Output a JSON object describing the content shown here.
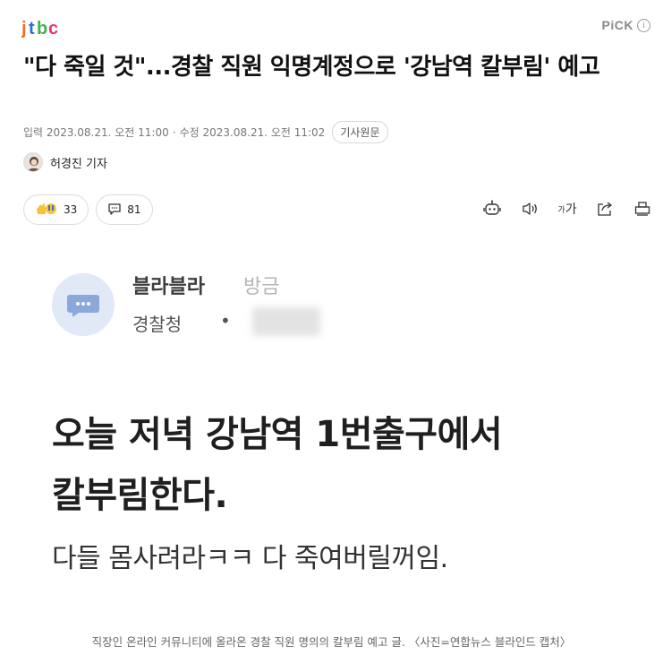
{
  "header": {
    "logo_text": "jtbc",
    "pick_label": "PiCK",
    "info_glyph": "i"
  },
  "article": {
    "title": "\"다 죽일 것\"...경찰 직원 익명계정으로 '강남역 칼부림' 예고",
    "meta": {
      "input_label": "입력",
      "input_time": "2023.08.21. 오전 11:00",
      "separator": "·",
      "modified_label": "수정",
      "modified_time": "2023.08.21. 오전 11:02",
      "original_button": "기사원문"
    },
    "author": "허경진 기자",
    "reactions_count": "33",
    "comments_count": "81",
    "photo": {
      "poster_name": "블라블라",
      "post_time": "방금",
      "poster_org": "경찰청",
      "org_dot": "•",
      "line1": "오늘 저녁 강남역 1번출구에서",
      "line2": "칼부림한다.",
      "line3": "다들 몸사려라ㅋㅋ 다 죽여버릴꺼임."
    },
    "caption": "직장인 온라인 커뮤니티에 올라온 경찰 직원 명의의 칼부림 예고 글. 〈사진=연합뉴스 블라인드 캡처〉"
  },
  "toolbar": {
    "font_size_label": "가",
    "font_size_small": "가"
  },
  "colors": {
    "logo_orange": "#f26b21",
    "logo_blue": "#2a6fd6",
    "logo_green": "#3fb34f",
    "logo_pink": "#e6357c"
  },
  "icons": [
    "info-icon",
    "reaction-emoji-icon",
    "comment-icon",
    "summary-bot-icon",
    "speaker-icon",
    "font-size-icon",
    "share-icon",
    "print-icon"
  ]
}
